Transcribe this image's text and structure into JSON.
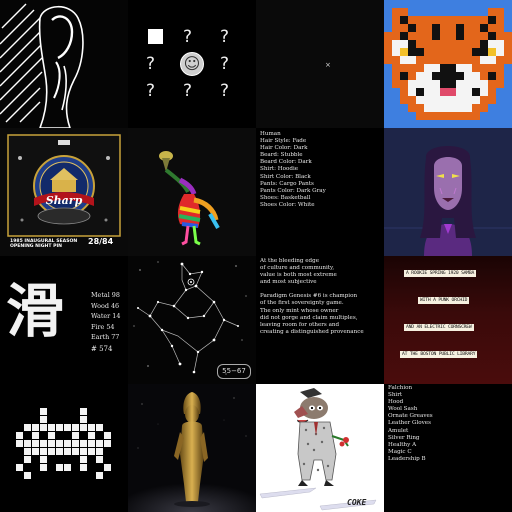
{
  "gallery": {
    "items": [
      {
        "name": "hooded-figure-art"
      },
      {
        "name": "mystery-grid-art",
        "question_mark": "?",
        "center_face": "☺"
      },
      {
        "name": "dark-sparse-art",
        "mark": "×"
      },
      {
        "name": "pixel-tiger-art"
      },
      {
        "name": "inaugural-season-pin",
        "subtitle": "1985 INAUGURAL SEASON",
        "subtitle2": "OPENING NIGHT PIN",
        "number": "28/84"
      },
      {
        "name": "rainbow-figure-art"
      },
      {
        "name": "traits-list",
        "lines": [
          "Human",
          "Hair Style: Fade",
          "Hair Color: Dark",
          "Beard: Stubble",
          "Beard Color: Dark",
          "Shirt: Hoodie",
          "Shirt Color: Black",
          "Pants: Cargo Pants",
          "Pants Color: Dark Gray",
          "Shoes: Basketball",
          "Shoes Color: White"
        ]
      },
      {
        "name": "cyber-woman-portrait"
      },
      {
        "name": "kanji-elements-card",
        "kanji": "滑",
        "stats": [
          "Metal 98",
          "Wood 46",
          "Water 14",
          "Fire 54",
          "Earth 77"
        ],
        "number": "# 574"
      },
      {
        "name": "constellation-art",
        "badge": "55−67"
      },
      {
        "name": "paradigm-genesis-text",
        "paragraphs": [
          [
            "At the bleeding edge",
            "of culture and community,",
            "value is both most extreme",
            "and most subjective"
          ],
          [
            "Paradigm Genesis #6 is champion",
            "of the first sovereignty game.",
            "The only mint whose owner",
            "did not gorge and claim multiples,",
            "leaving room for others and",
            "creating a distinguished provenance"
          ]
        ]
      },
      {
        "name": "banner-text-art",
        "lines": [
          "A ROOKIE SPRING 1920 SAMBA",
          "WITH A PUNK ORCHID",
          "AND AN ELECTRIC CORNSCREW",
          "AT THE BOSTON PUBLIC LIBRARY"
        ]
      },
      {
        "name": "pixel-invader-art"
      },
      {
        "name": "golden-statue-art"
      },
      {
        "name": "cartoon-dog-suit-art",
        "label": "COKE"
      },
      {
        "name": "loot-list",
        "lines": [
          "Falchion",
          "Shirt",
          "Hood",
          "Wool Sash",
          "Ornate Greaves",
          "Leather Gloves",
          "Amulet",
          "Silver Ring",
          "Healthy A",
          "Magic C",
          "Leadership B"
        ]
      }
    ]
  },
  "colors": {
    "background": "#000000",
    "text": "#e8e8e8",
    "banner_bg": "#3a0a0a",
    "banner_box": "#f6f0e0",
    "tiger_orange": "#e3661b",
    "tiger_blue": "#3e7fe0",
    "gold": "#c39a3a"
  }
}
